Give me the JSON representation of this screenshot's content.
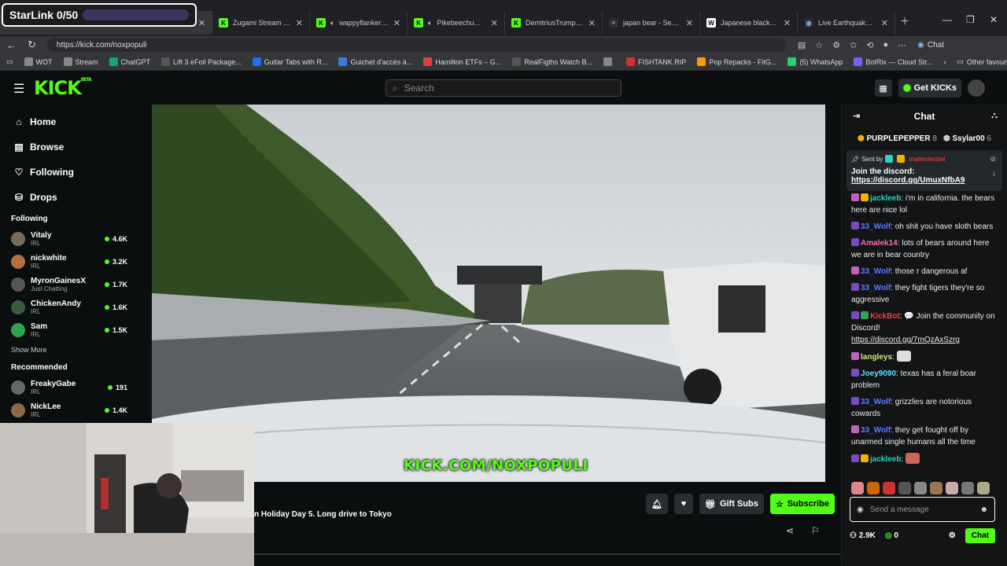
{
  "overlay": {
    "starlink": "StarLink 0/50"
  },
  "tabs": [
    {
      "title": "Zugami Stream - W",
      "icon": "kick-favicon"
    },
    {
      "title": "wappyflanker Strea",
      "icon": "kick-favicon"
    },
    {
      "title": "Pikebeechum Strea",
      "icon": "kick-favicon"
    },
    {
      "title": "DemitriusTrump Stream",
      "icon": "kick-favicon"
    },
    {
      "title": "japan bear - Search",
      "icon": "search-favicon"
    },
    {
      "title": "Japanese black bear - W",
      "icon": "wikipedia-favicon"
    },
    {
      "title": "Live Earthquake Tracker",
      "icon": "globe-favicon"
    }
  ],
  "browser": {
    "url": "https://kick.com/noxpopuli",
    "chat_label": "Chat"
  },
  "bookmarks": [
    "WOT",
    "Stream",
    "ChatGPT",
    "Lift 3 eFoil Package...",
    "Guitar Tabs with R...",
    "Guichet d'accès à...",
    "Hamilton ETFs – G...",
    "RealFigths Watch B...",
    "",
    "FISHTANK.RIP",
    "Pop Repacks - FitG...",
    "(5) WhatsApp",
    "BotRix — Cloud Str..."
  ],
  "bookmarks_other": "Other favourites",
  "header": {
    "logo": "KICK",
    "logo_beta": "BETA",
    "search_placeholder": "Search",
    "get_kicks": "Get KICKs"
  },
  "nav": [
    {
      "label": "Home",
      "icon": "home-icon"
    },
    {
      "label": "Browse",
      "icon": "browse-icon"
    },
    {
      "label": "Following",
      "icon": "heart-icon"
    },
    {
      "label": "Drops",
      "icon": "drops-icon"
    }
  ],
  "following_heading": "Following",
  "following": [
    {
      "name": "Vitaly",
      "category": "IRL",
      "viewers": "4.6K",
      "color": "#7a6a5a"
    },
    {
      "name": "nickwhite",
      "category": "IRL",
      "viewers": "3.2K",
      "color": "#b07040"
    },
    {
      "name": "MyronGainesX",
      "category": "Just Chatting",
      "viewers": "1.7K",
      "color": "#555"
    },
    {
      "name": "ChickenAndy",
      "category": "IRL",
      "viewers": "1.6K",
      "color": "#3a5a3a"
    },
    {
      "name": "Sam",
      "category": "IRL",
      "viewers": "1.5K",
      "color": "#2ea44f"
    }
  ],
  "show_more": "Show More",
  "recommended_heading": "Recommended",
  "recommended": [
    {
      "name": "FreakyGabe",
      "category": "IRL",
      "viewers": "191",
      "color": "#666"
    },
    {
      "name": "NickLee",
      "category": "IRL",
      "viewers": "1.4K",
      "color": "#8a6a4a"
    }
  ],
  "stream": {
    "watermark": "KICK.COM/NOXPOPULI",
    "title": "n Holiday Day 5. Long drive to Tokyo",
    "gift_subs": "Gift Subs",
    "subscribe": "Subscribe"
  },
  "chat": {
    "title": "Chat",
    "leaders": [
      {
        "name": "PURPLEPEPPER",
        "count": "8"
      },
      {
        "name": "Ssylar00",
        "count": "6"
      }
    ],
    "pinned": {
      "sent_by": "Sent by",
      "user": "mattentenbel",
      "text": "Join the discord:",
      "link": "https://discord.gg/UmuxNfbA9"
    },
    "messages": [
      {
        "user": "jackleeb",
        "color": "#2bd4c4",
        "text": "i'm in california. the bears here are nice lol"
      },
      {
        "user": "33_Wolf",
        "color": "#5c7cff",
        "text": "oh shit you have sloth bears"
      },
      {
        "user": "Amalek14",
        "color": "#ff6fb0",
        "text": "lots of bears around here we are in bear country"
      },
      {
        "user": "33_Wolf",
        "color": "#5c7cff",
        "text": "those r dangerous af"
      },
      {
        "user": "33_Wolf",
        "color": "#5c7cff",
        "text": "they fight tigers they're so aggressive"
      },
      {
        "user": "KickBot",
        "color": "#ff3b3b",
        "text": "💬 Join the community on Discord!",
        "link": "https://discord.gg/7mQzAxSzrg"
      },
      {
        "user": "langleys",
        "color": "#c8f08c",
        "text": ""
      },
      {
        "user": "Joey9090",
        "color": "#5ee0ff",
        "text": "texas has a feral boar problem"
      },
      {
        "user": "33_Wolf",
        "color": "#5c7cff",
        "text": "grizzlies are notorious cowards"
      },
      {
        "user": "33_Wolf",
        "color": "#5c7cff",
        "text": "they get fought off by unarmed single humans all the time"
      },
      {
        "user": "jackleeb",
        "color": "#2bd4c4",
        "text": ""
      }
    ],
    "input_placeholder": "Send a message",
    "viewers": "2.9K",
    "points": "0",
    "send_label": "Chat"
  }
}
